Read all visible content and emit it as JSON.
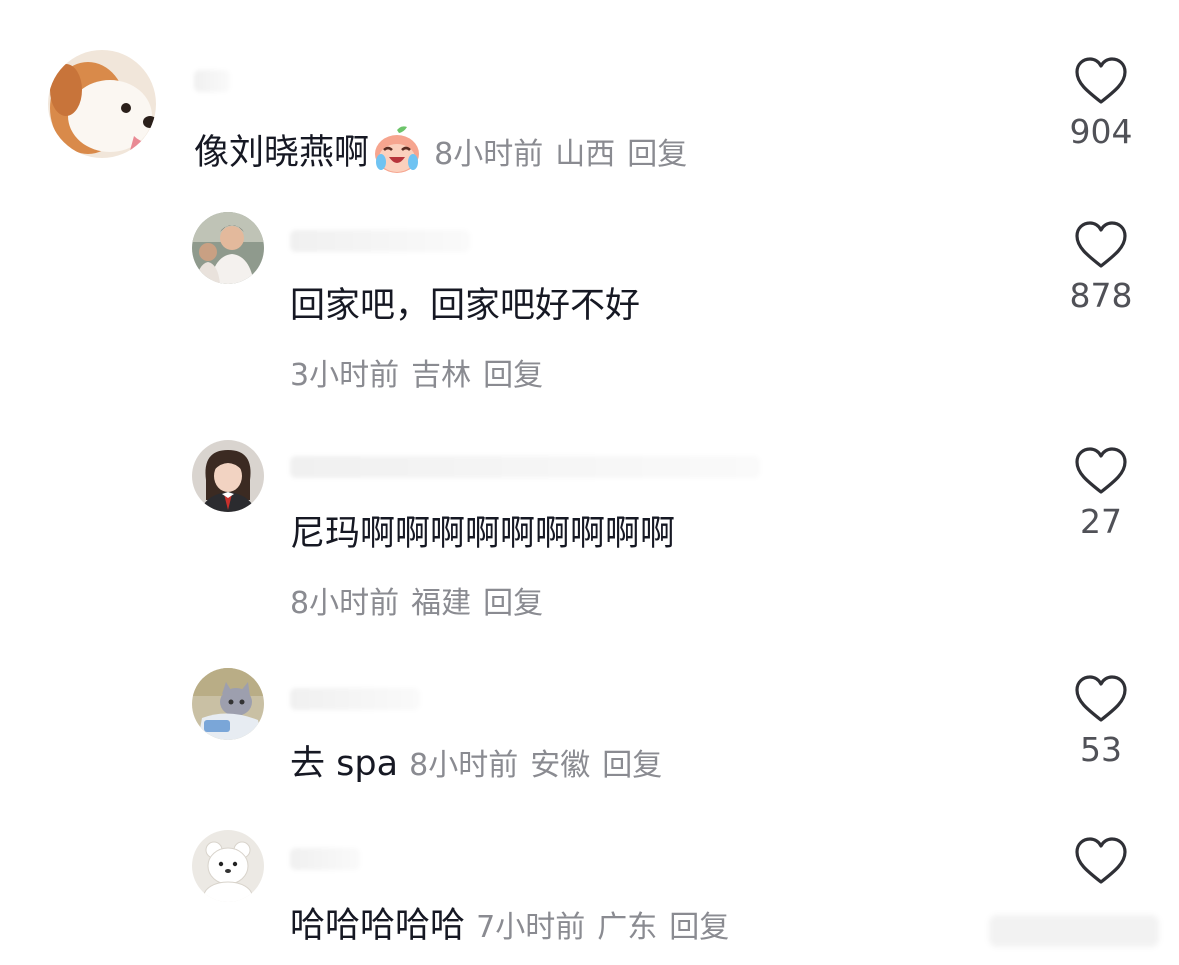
{
  "comments": [
    {
      "text": "像刘晓燕啊",
      "has_emoji": true,
      "time": "8小时前",
      "location": "山西",
      "reply_label": "回复",
      "likes": "904",
      "avatar": "shiba-dog-avatar"
    },
    {
      "text": "回家吧，回家吧好不好",
      "time": "3小时前",
      "location": "吉林",
      "reply_label": "回复",
      "likes": "878",
      "avatar": "person-photo-avatar"
    },
    {
      "text": "尼玛啊啊啊啊啊啊啊啊啊",
      "time": "8小时前",
      "location": "福建",
      "reply_label": "回复",
      "likes": "27",
      "avatar": "girl-photo-avatar"
    },
    {
      "text": "去 spa",
      "time": "8小时前",
      "location": "安徽",
      "reply_label": "回复",
      "likes": "53",
      "avatar": "cat-photo-avatar"
    },
    {
      "text": "哈哈哈哈哈",
      "time": "7小时前",
      "location": "广东",
      "reply_label": "回复",
      "likes": "",
      "avatar": "white-bear-avatar"
    }
  ],
  "colors": {
    "text": "#161823",
    "meta": "#8a8b91",
    "like_count": "#505157",
    "heart_stroke": "#2f3036"
  }
}
